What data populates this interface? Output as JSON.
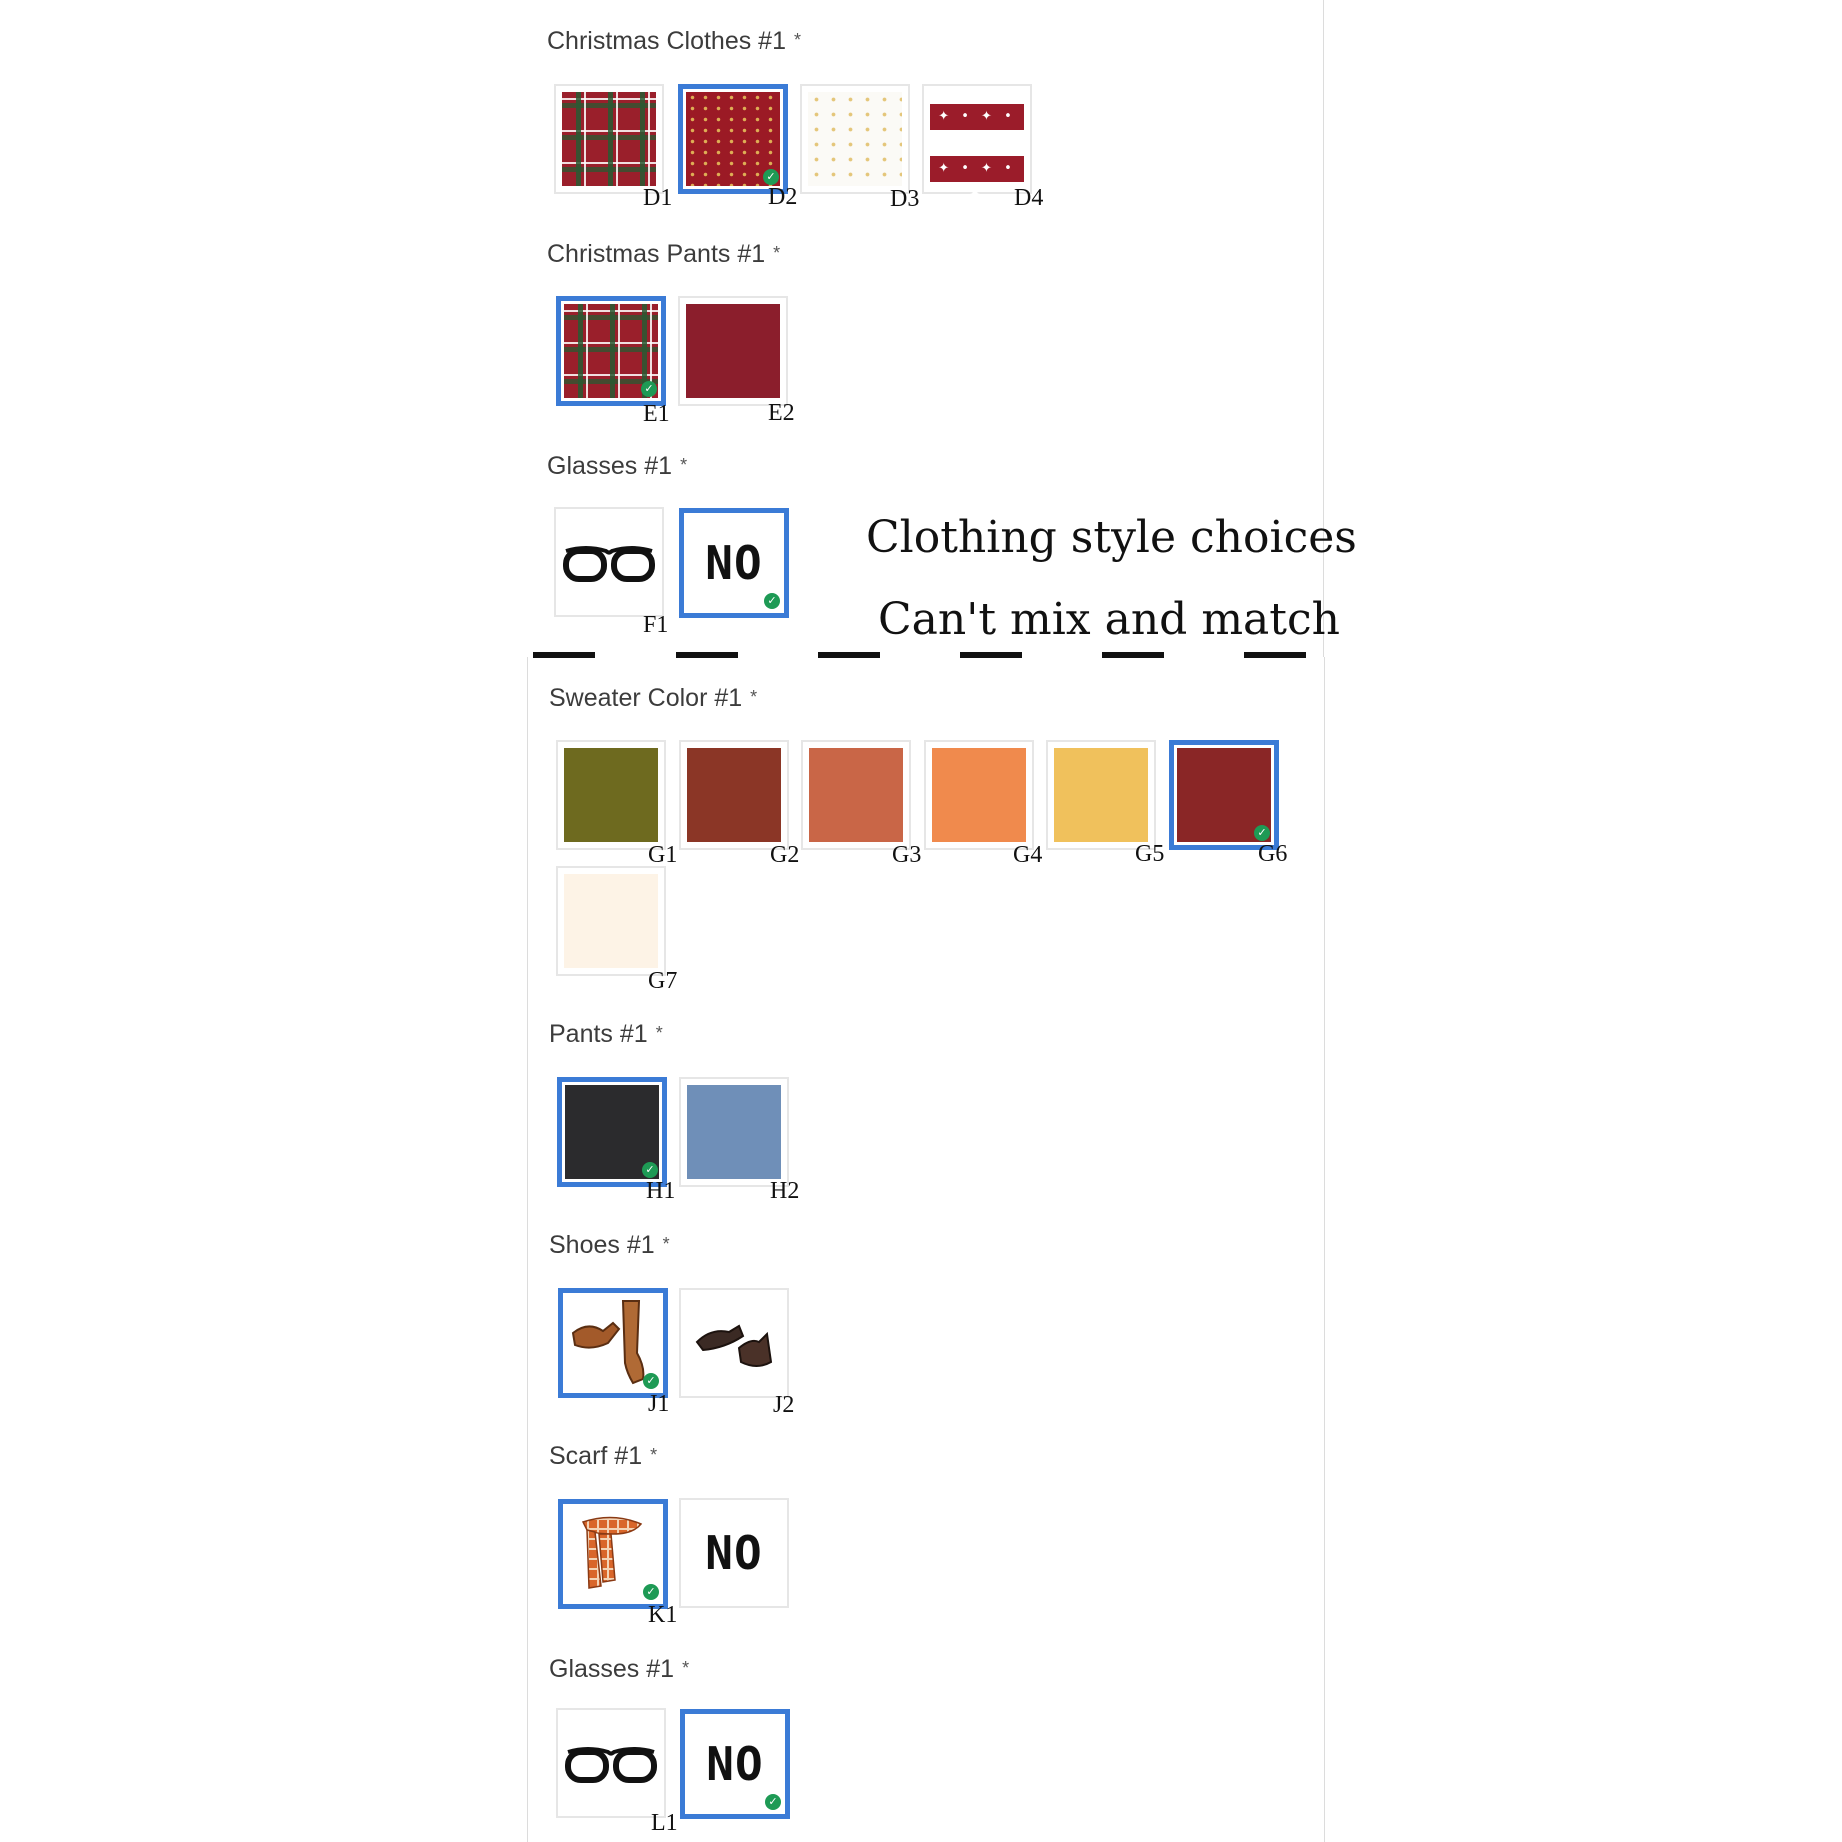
{
  "sections": {
    "christmas_clothes": {
      "label": "Christmas Clothes #1",
      "codes": [
        "D1",
        "D2",
        "D3",
        "D4"
      ],
      "selected": "D2",
      "d4_pattern": "✦ • ✦ • ✦"
    },
    "christmas_pants": {
      "label": "Christmas Pants #1",
      "codes": [
        "E1",
        "E2"
      ],
      "selected": "E1"
    },
    "glasses_top": {
      "label": "Glasses #1",
      "codes": [
        "F1"
      ],
      "no_option": "NO",
      "selected": "NO"
    },
    "sweater_color": {
      "label": "Sweater Color #1",
      "codes": [
        "G1",
        "G2",
        "G3",
        "G4",
        "G5",
        "G6",
        "G7"
      ],
      "colors": [
        "#6e6a1f",
        "#8b3626",
        "#c96647",
        "#f08a4d",
        "#f0c15c",
        "#8a2626",
        "#fdf3e6"
      ],
      "selected": "G6"
    },
    "pants": {
      "label": "Pants #1",
      "codes": [
        "H1",
        "H2"
      ],
      "colors": [
        "#2b2b2d",
        "#6f8fb8"
      ],
      "selected": "H1"
    },
    "shoes": {
      "label": "Shoes #1",
      "codes": [
        "J1",
        "J2"
      ],
      "selected": "J1"
    },
    "scarf": {
      "label": "Scarf #1",
      "codes": [
        "K1"
      ],
      "no_option": "NO",
      "selected": "K1"
    },
    "glasses_bottom": {
      "label": "Glasses #1",
      "codes": [
        "L1"
      ],
      "no_option": "NO",
      "selected": "NO"
    }
  },
  "required_mark": "*",
  "check_glyph": "✓",
  "annotation": {
    "line1": "Clothing style choices",
    "line2": "Can't mix and match"
  },
  "accent_color": "#3b7bd6",
  "check_color": "#1e9a55"
}
